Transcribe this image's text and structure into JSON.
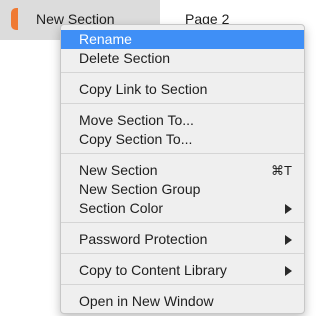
{
  "tabs": [
    {
      "label": "New Section",
      "active": true,
      "color": "#ef7a33"
    },
    {
      "label": "Page 2",
      "active": false
    }
  ],
  "menu": {
    "items": [
      {
        "label": "Rename",
        "highlighted": true
      },
      {
        "label": "Delete Section"
      },
      {
        "label": "Copy Link to Section"
      },
      {
        "label": "Move Section To..."
      },
      {
        "label": "Copy Section To..."
      },
      {
        "label": "New Section",
        "shortcut": "⌘T"
      },
      {
        "label": "New Section Group"
      },
      {
        "label": "Section Color",
        "submenu": true
      },
      {
        "label": "Password Protection",
        "submenu": true
      },
      {
        "label": "Copy to Content Library",
        "submenu": true
      },
      {
        "label": "Open in New Window"
      }
    ]
  },
  "colors": {
    "highlight": "#3f8ff6",
    "menu_background": "#efefef",
    "section_tab_accent": "#ef7a33"
  }
}
